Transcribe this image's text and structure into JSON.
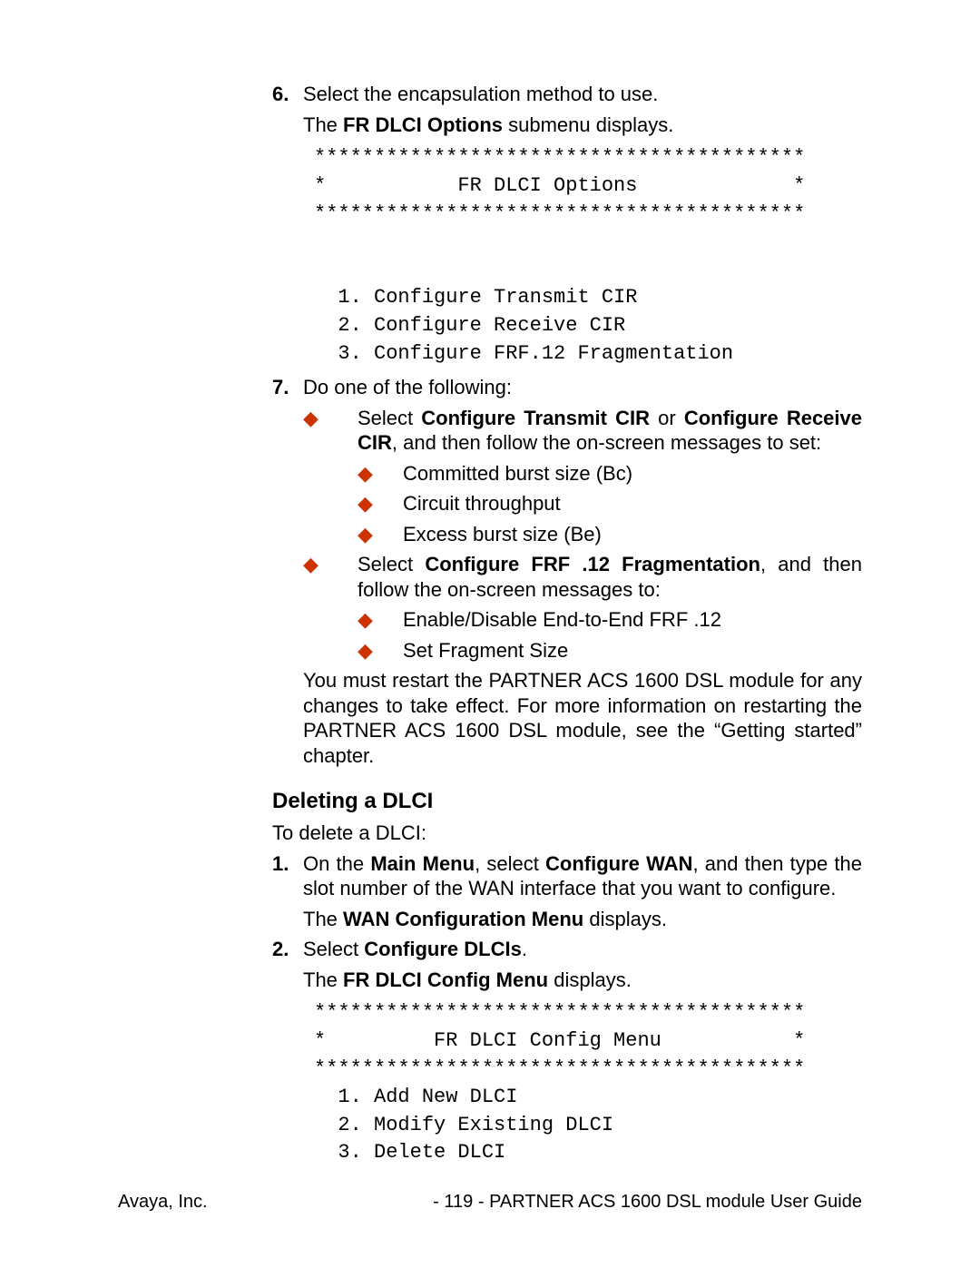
{
  "steps6": {
    "marker": "6.",
    "line1_a": "Select the encapsulation method to use.",
    "line2_a": "The ",
    "line2_b": "FR DLCI Options",
    "line2_c": " submenu displays.",
    "mono": "*****************************************\n*           FR DLCI Options             *\n*****************************************\n\n\n  1. Configure Transmit CIR\n  2. Configure Receive CIR\n  3. Configure FRF.12 Fragmentation"
  },
  "steps7": {
    "marker": "7.",
    "intro": "Do one of the following:",
    "bullets": [
      {
        "text_a": "Select ",
        "b1": "Configure Transmit CIR",
        "mid1": " or ",
        "b2": "Configure Receive CIR",
        "text_b": ", and then follow the on-screen messages to set:",
        "subs": [
          "Committed burst size (Bc)",
          "Circuit throughput",
          "Excess burst size (Be)"
        ]
      },
      {
        "text_a": "Select ",
        "b1": "Configure FRF .12 Fragmentation",
        "mid1": "",
        "b2": "",
        "text_b": ", and then follow the on-screen messages to:",
        "subs": [
          "Enable/Disable End-to-End FRF .12",
          "Set Fragment Size"
        ]
      }
    ],
    "tail": "You must restart the PARTNER ACS 1600 DSL module for any changes to take effect.  For more information on restarting the PARTNER ACS 1600 DSL module, see the “Getting started” chapter."
  },
  "section": {
    "heading": "Deleting a DLCI",
    "intro": "To delete a DLCI:",
    "step1": {
      "marker": "1.",
      "a": "On the ",
      "b1": "Main Menu",
      "mid": ", select ",
      "b2": "Configure WAN",
      "c": ", and then type the slot number of the WAN interface that you want to configure.",
      "line2_a": "The ",
      "line2_b": "WAN Configuration Menu",
      "line2_c": " displays."
    },
    "step2": {
      "marker": "2.",
      "a": "Select ",
      "b1": "Configure DLCIs",
      "c": ".",
      "line2_a": "The ",
      "line2_b": "FR DLCI Config Menu",
      "line2_c": " displays.",
      "mono": "*****************************************\n*         FR DLCI Config Menu           *\n*****************************************\n  1. Add New DLCI\n  2. Modify Existing DLCI\n  3. Delete DLCI"
    }
  },
  "footer": {
    "left": "Avaya, Inc.",
    "center": "- 119 -",
    "right": "PARTNER ACS 1600 DSL module User Guide"
  }
}
